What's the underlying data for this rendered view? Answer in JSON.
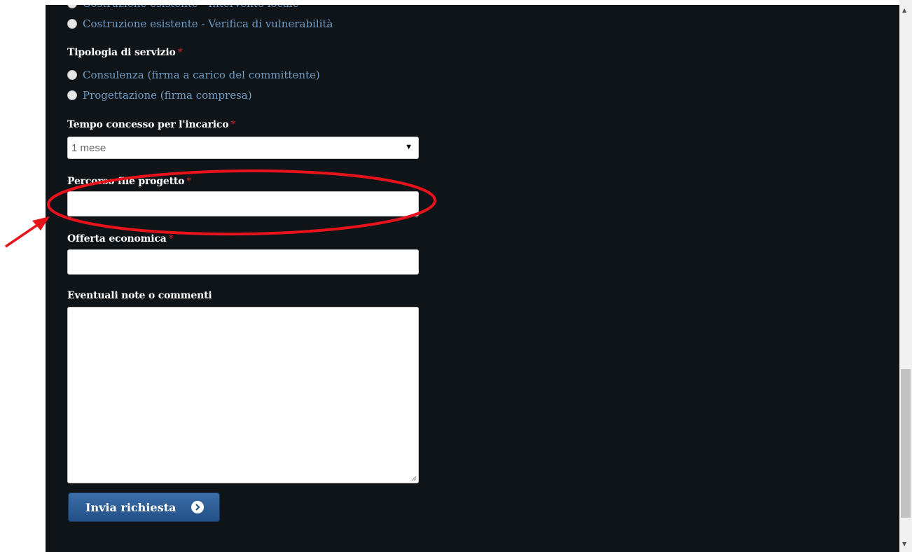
{
  "form": {
    "partial_option": "Costruzione esistente - Intervento locale",
    "tipologia_costruzione": {
      "options": [
        "Costruzione esistente - Verifica di vulnerabilità"
      ]
    },
    "tipologia_servizio": {
      "label": "Tipologia di servizio",
      "options": [
        "Consulenza (firma a carico del committente)",
        "Progettazione (firma compresa)"
      ]
    },
    "tempo": {
      "label": "Tempo concesso per l'incarico",
      "value": "1 mese"
    },
    "percorso": {
      "label": "Percorso file progetto",
      "value": ""
    },
    "offerta": {
      "label": "Offerta economica",
      "value": ""
    },
    "note": {
      "label": "Eventuali note o commenti",
      "value": ""
    },
    "required_mark": "*",
    "submit_label": "Invia richiesta"
  },
  "colors": {
    "panel": "#0f1419",
    "link": "#6e9cc4",
    "required": "#cc2222",
    "button": "#2d5d96",
    "annotation": "#e8121b"
  },
  "icons": {
    "submit": "chevron-right-icon",
    "select": "caret-down-icon"
  }
}
